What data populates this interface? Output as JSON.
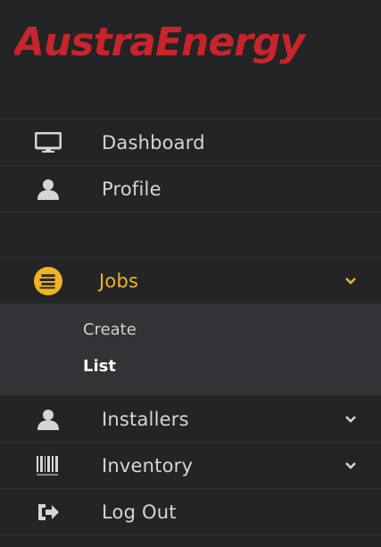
{
  "brand": {
    "part1": "Austra",
    "part2": "Energy",
    "color1": "#c7252b",
    "color2": "#c7252b"
  },
  "nav": {
    "items": [
      {
        "label": "Dashboard",
        "icon": "monitor-icon"
      },
      {
        "label": "Profile",
        "icon": "user-icon"
      },
      {
        "label": "Jobs",
        "icon": "jobs-icon",
        "expanded": true,
        "submenu": [
          {
            "label": "Create"
          },
          {
            "label": "List",
            "current": true
          }
        ]
      },
      {
        "label": "Installers",
        "icon": "user-icon"
      },
      {
        "label": "Inventory",
        "icon": "barcode-icon"
      },
      {
        "label": "Log Out",
        "icon": "logout-icon"
      }
    ]
  },
  "colors": {
    "background": "#222426",
    "active": "#f0b323",
    "submenu_bg": "#313336"
  }
}
